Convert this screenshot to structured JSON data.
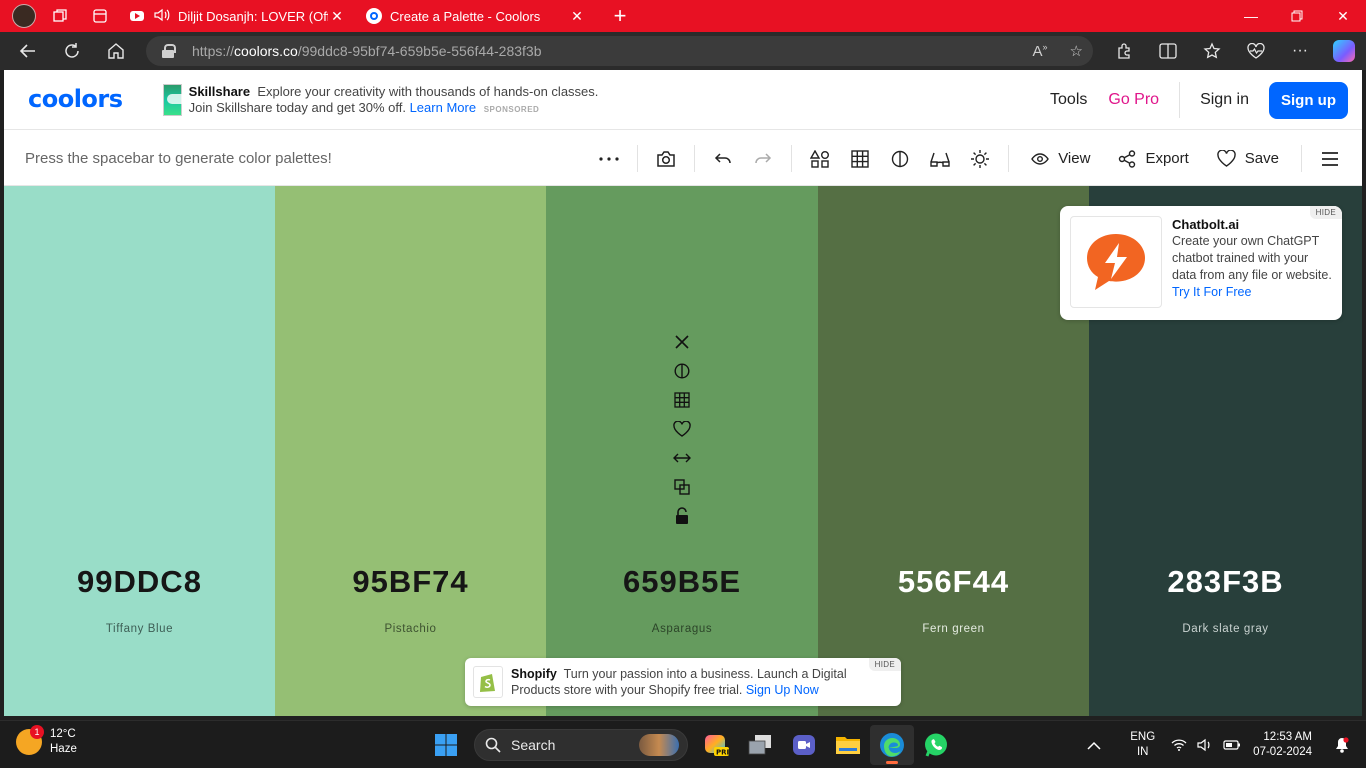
{
  "browser": {
    "tabs": [
      {
        "title": "Diljit Dosanjh: LOVER (Offici",
        "active": false
      },
      {
        "title": "Create a Palette - Coolors",
        "active": true
      }
    ],
    "url_scheme": "https://",
    "url_host": "coolors.co",
    "url_path": "/99ddc8-95bf74-659b5e-556f44-283f3b"
  },
  "header": {
    "logo": "coolors",
    "ad": {
      "brand": "Skillshare",
      "text": "Explore your creativity with thousands of hands-on classes. Join Skillshare today and get 30% off.",
      "link": "Learn More",
      "tag": "SPONSORED"
    },
    "tools": "Tools",
    "go_pro": "Go Pro",
    "sign_in": "Sign in",
    "sign_up": "Sign up"
  },
  "toolbar": {
    "hint": "Press the spacebar to generate color palettes!",
    "view": "View",
    "export": "Export",
    "save": "Save"
  },
  "palette": [
    {
      "hex": "99DDC8",
      "name": "Tiffany Blue",
      "color": "#99ddc8",
      "text": "#161616",
      "sub": "#3d5e55"
    },
    {
      "hex": "95BF74",
      "name": "Pistachio",
      "color": "#95bf74",
      "text": "#161616",
      "sub": "#3d5230"
    },
    {
      "hex": "659B5E",
      "name": "Asparagus",
      "color": "#659b5e",
      "text": "#161616",
      "sub": "#2c4529"
    },
    {
      "hex": "556F44",
      "name": "Fern green",
      "color": "#556f44",
      "text": "#ffffff",
      "sub": "#e6ece2"
    },
    {
      "hex": "283F3B",
      "name": "Dark slate gray",
      "color": "#283f3b",
      "text": "#ffffff",
      "sub": "#c9d2d0"
    }
  ],
  "ad_card": {
    "hide": "HIDE",
    "title": "Chatbolt.ai",
    "body": "Create your own ChatGPT chatbot trained with your data from any file or website.",
    "link": "Try It For Free"
  },
  "ad_bottom": {
    "hide": "HIDE",
    "brand": "Shopify",
    "text": "Turn your passion into a business. Launch a Digital Products store with your Shopify free trial.",
    "link": "Sign Up Now"
  },
  "taskbar": {
    "weather_temp": "12°C",
    "weather_desc": "Haze",
    "weather_badge": "1",
    "search": "Search",
    "lang_1": "ENG",
    "lang_2": "IN",
    "time": "12:53 AM",
    "date": "07-02-2024"
  }
}
